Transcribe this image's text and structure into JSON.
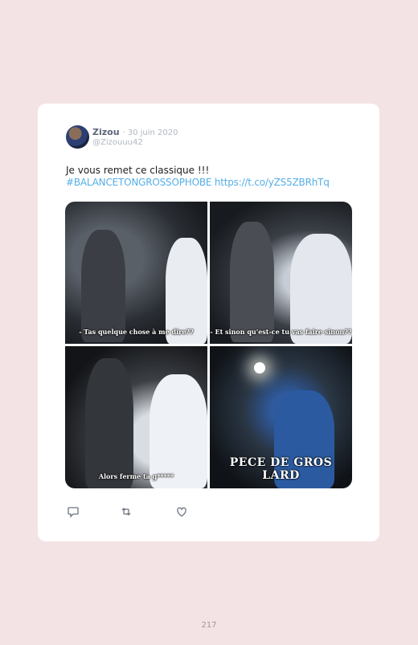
{
  "tweet": {
    "name": "Zizou",
    "date": "· 30 juin 2020",
    "handle": "@Zizouuu42",
    "text_line1": "Je vous remet ce classique !!!",
    "text_line2": "#BALANCETONGROSSOPHOBE https://t.co/yZS5ZBRhTq",
    "images": [
      {
        "caption": "- Tas quelque chose à me dire??"
      },
      {
        "caption": "- Et sinon qu'est-ce tu vas faire sinon??"
      },
      {
        "caption": "Alors ferme ta g*****"
      },
      {
        "caption": "PECE DE GROS LARD"
      }
    ],
    "actions": [
      "reply-icon",
      "retweet-icon",
      "like-icon"
    ]
  },
  "page_number": "217"
}
